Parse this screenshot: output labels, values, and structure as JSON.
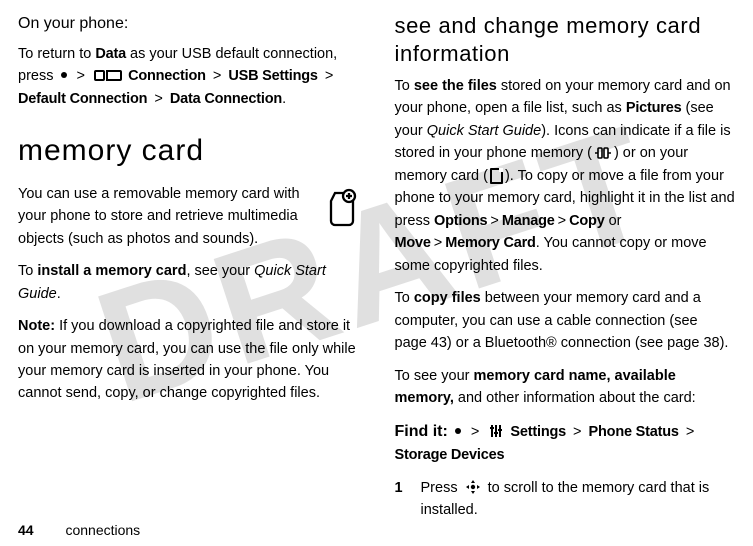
{
  "watermark": "DRAFT",
  "left": {
    "subhead": "On your phone:",
    "p1_a": "To return to ",
    "p1_data": "Data",
    "p1_b": " as your USB default connection, press ",
    "nav_connection": "Connection",
    "nav_usb": "USB Settings",
    "nav_default": "Default Connection",
    "nav_dataconn": "Data Connection",
    "period": ".",
    "h1": "memory card",
    "p2": "You can use a removable memory card with your phone to store and retrieve multimedia objects (such as photos and sounds).",
    "p3_a": "To ",
    "p3_b": "install a memory card",
    "p3_c": ", see your ",
    "p3_d": "Quick Start Guide",
    "p4_label": "Note:",
    "p4_text": " If you download a copyrighted file and store it on your memory card, you can use the file only while your memory card is inserted in your phone. You cannot send, copy, or change copyrighted files."
  },
  "right": {
    "h2": "see and change memory card information",
    "p1_a": "To ",
    "p1_b": "see the files",
    "p1_c": " stored on your memory card and on your phone, open a file list, such as ",
    "p1_pictures": "Pictures",
    "p1_d": " (see your ",
    "p1_qsg": "Quick Start Guide",
    "p1_e": "). Icons can indicate if a file is stored in your phone memory (",
    "p1_f": ") or on your memory card (",
    "p1_g": "). To copy or move a file from your phone to your memory card, highlight it in the list and press ",
    "opt": "Options",
    "manage": "Manage",
    "copy": "Copy",
    "or": " or ",
    "move": "Move",
    "memcard": "Memory Card",
    "p1_h": ". You cannot copy or move some copyrighted files.",
    "p2_a": "To ",
    "p2_b": "copy files",
    "p2_c": " between your memory card and a computer, you can use a cable connection (see page 43) or a Bluetooth® connection (see page 38).",
    "p3_a": "To see your ",
    "p3_b": "memory card name, available memory,",
    "p3_c": " and other information about the card:",
    "findit": "Find it:",
    "settings": "Settings",
    "phonestatus": "Phone Status",
    "storage": "Storage Devices",
    "step_num": "1",
    "step_a": "Press ",
    "step_b": " to scroll to the memory card that is installed."
  },
  "gt": ">",
  "footer": {
    "page": "44",
    "section": "connections"
  }
}
